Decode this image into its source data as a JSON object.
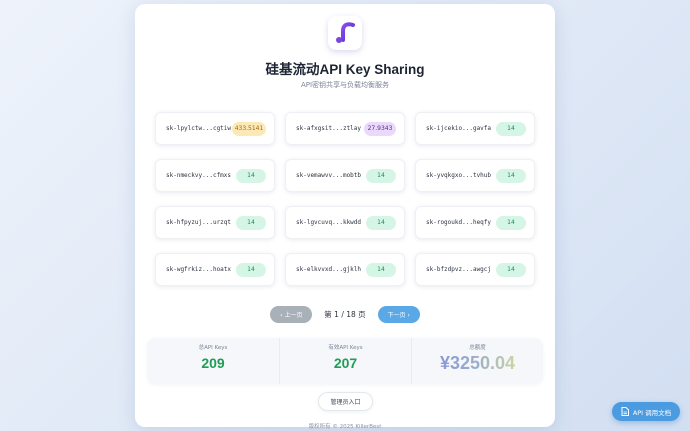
{
  "header": {
    "title": "硅基流动API Key Sharing",
    "subtitle": "API密钥共享与负载均衡服务"
  },
  "keys": [
    {
      "key": "sk-lpylctw...cgtiw",
      "balance": "433.5141",
      "badge_style": "orange"
    },
    {
      "key": "sk-afxgsit...ztlay",
      "balance": "27.9343",
      "badge_style": "purple"
    },
    {
      "key": "sk-ijcekio...gavfa",
      "balance": "14",
      "badge_style": "green"
    },
    {
      "key": "sk-nmeckvy...cfmxs",
      "balance": "14",
      "badge_style": "green"
    },
    {
      "key": "sk-vemawvv...mobtb",
      "balance": "14",
      "badge_style": "green"
    },
    {
      "key": "sk-yvqkgxo...tvhub",
      "balance": "14",
      "badge_style": "green"
    },
    {
      "key": "sk-hfpyzuj...urzqt",
      "balance": "14",
      "badge_style": "green"
    },
    {
      "key": "sk-lgvcuvq...kkwdd",
      "balance": "14",
      "badge_style": "green"
    },
    {
      "key": "sk-rogoukd...heqfy",
      "balance": "14",
      "badge_style": "green"
    },
    {
      "key": "sk-wgfrkiz...hoatx",
      "balance": "14",
      "badge_style": "green"
    },
    {
      "key": "sk-elkvvxd...gjklh",
      "balance": "14",
      "badge_style": "green"
    },
    {
      "key": "sk-bfzdpvz...awgcj",
      "balance": "14",
      "badge_style": "green"
    }
  ],
  "pagination": {
    "prev_label": "‹ 上一页",
    "page_info": "第 1 / 18 页",
    "next_label": "下一页 ›"
  },
  "stats": {
    "total_keys_label": "总API Keys",
    "total_keys_value": "209",
    "valid_keys_label": "有效API Keys",
    "valid_keys_value": "207",
    "total_balance_label": "总额度",
    "total_balance_value": "¥3250.04"
  },
  "admin_button_label": "管理员入口",
  "footer": "版权所有 © 2025 KillerBest",
  "doc_button_label": "API 调用文档",
  "icons": {
    "logo": "siliconflow-logo-icon",
    "doc": "document-icon"
  },
  "colors": {
    "accent": "#5aa8e6",
    "brand": "#6a3fd8",
    "positive": "#1f9d55"
  }
}
